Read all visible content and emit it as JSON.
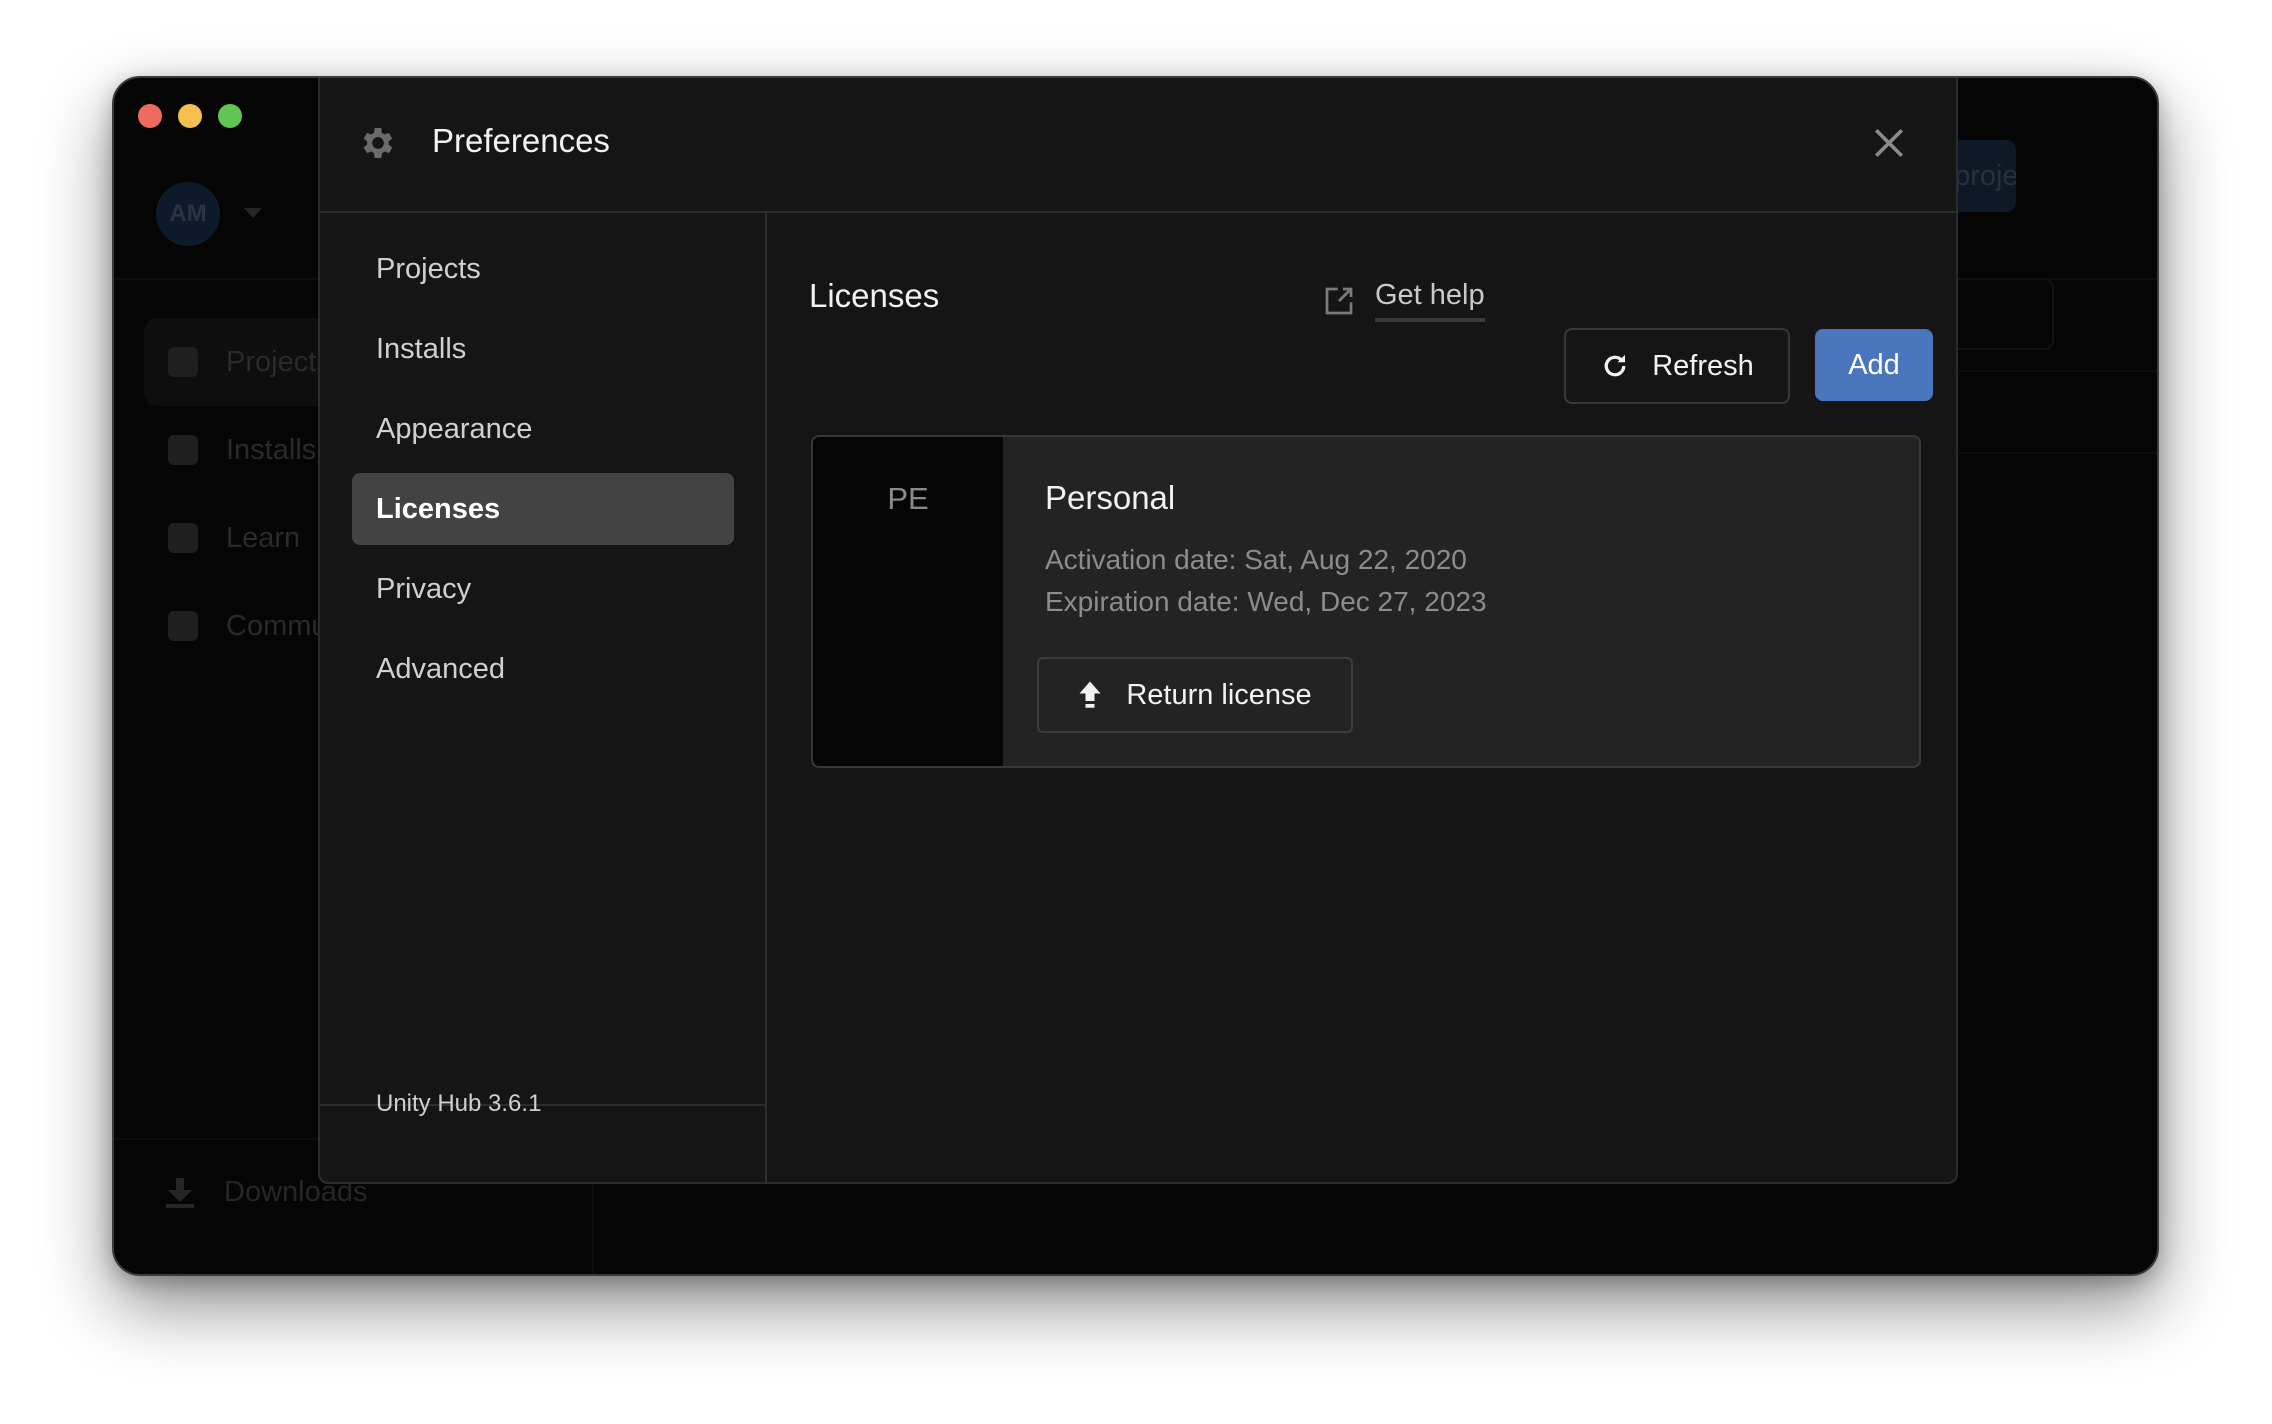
{
  "window": {
    "traffic_lights": [
      "close",
      "minimize",
      "zoom"
    ]
  },
  "background_app": {
    "avatar_initials": "AM",
    "nav_items": [
      {
        "label": "Projects",
        "icon": "cube-icon"
      },
      {
        "label": "Installs",
        "icon": "tray-icon"
      },
      {
        "label": "Learn",
        "icon": "graduation-cap-icon"
      },
      {
        "label": "Community",
        "icon": "people-icon"
      }
    ],
    "downloads_label": "Downloads",
    "new_project_label": "New project"
  },
  "dialog": {
    "title": "Preferences",
    "title_icon": "gear-icon",
    "close_icon": "close-icon",
    "nav": [
      {
        "label": "Projects",
        "active": false
      },
      {
        "label": "Installs",
        "active": false
      },
      {
        "label": "Appearance",
        "active": false
      },
      {
        "label": "Licenses",
        "active": true
      },
      {
        "label": "Privacy",
        "active": false
      },
      {
        "label": "Advanced",
        "active": false
      }
    ],
    "version": "Unity Hub 3.6.1"
  },
  "licenses": {
    "title": "Licenses",
    "get_help_label": "Get help",
    "refresh_label": "Refresh",
    "add_label": "Add",
    "accent_color": "#4a76bd",
    "items": [
      {
        "badge": "PE",
        "name": "Personal",
        "activation": "Activation date: Sat, Aug 22, 2020",
        "expiration": "Expiration date: Wed, Dec 27, 2023",
        "return_label": "Return license"
      }
    ]
  }
}
